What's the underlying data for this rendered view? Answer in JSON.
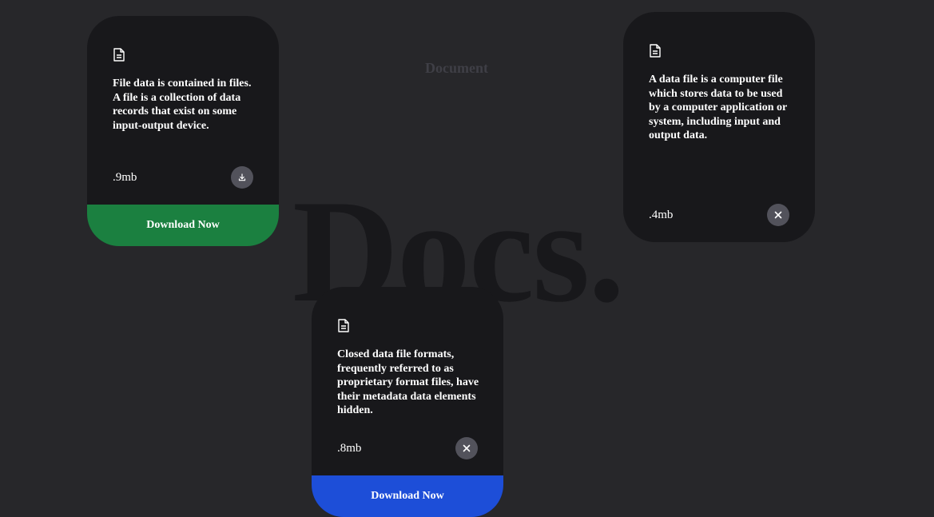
{
  "header": {
    "heading": "Document",
    "big_title": "Docs."
  },
  "cards": [
    {
      "text": "File data is contained in files. A file is a collection of data records that exist on some input-output device.",
      "size": ".9mb",
      "action_icon": "download-icon",
      "button_label": "Download Now",
      "button_color": "#1b8040"
    },
    {
      "text": "A data file is a computer file which stores data to be used by a computer application or system, including input and output data.",
      "size": ".4mb",
      "action_icon": "close-icon"
    },
    {
      "text": "Closed data file formats, frequently referred to as proprietary format files, have their metadata data elements hidden.",
      "size": ".8mb",
      "action_icon": "close-icon",
      "button_label": "Download Now",
      "button_color": "#1d4ed8"
    }
  ],
  "colors": {
    "background": "#27272a",
    "card": "#18181b",
    "icon_button": "#52525b",
    "heading": "#3f3f46",
    "big_title": "#18181b"
  }
}
